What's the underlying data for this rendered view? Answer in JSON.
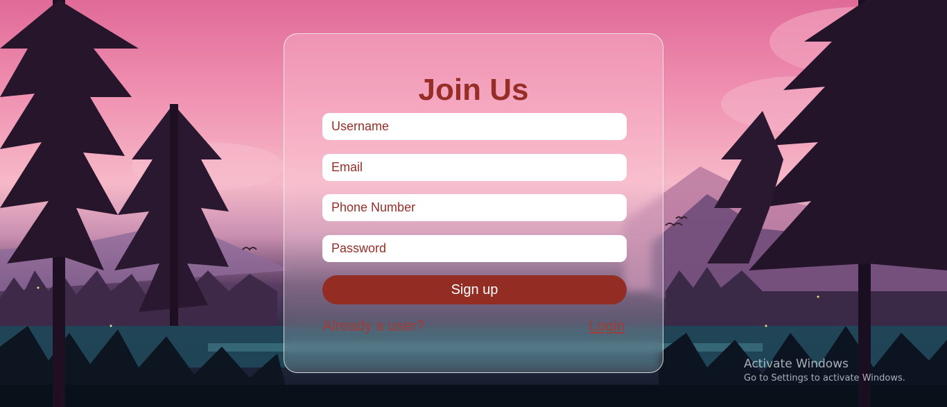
{
  "form": {
    "title": "Join Us",
    "username_placeholder": "Username",
    "email_placeholder": "Email",
    "phone_placeholder": "Phone Number",
    "password_placeholder": "Password",
    "signup_label": "Sign up",
    "already_user_text": "Already a user?",
    "login_label": "Login"
  },
  "watermark": {
    "line1": "Activate Windows",
    "line2": "Go to Settings to activate Windows."
  },
  "colors": {
    "accent": "#962e27",
    "button": "#932d23"
  }
}
